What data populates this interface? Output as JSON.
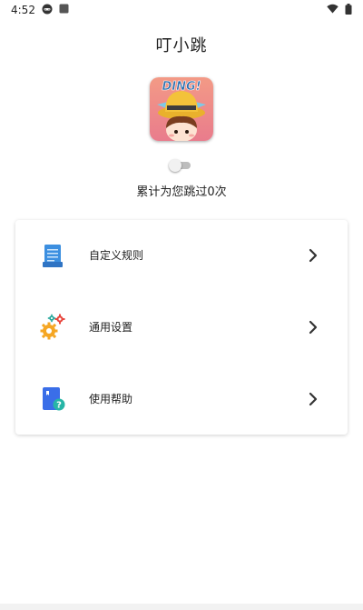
{
  "status_bar": {
    "time": "4:52",
    "icons": [
      "game-controller-icon",
      "square-app-icon",
      "wifi-icon",
      "battery-icon"
    ]
  },
  "app": {
    "title": "叮小跳",
    "logo_text": "DING!"
  },
  "toggle": {
    "enabled": false
  },
  "stats": {
    "skip_count_text": "累计为您跳过0次"
  },
  "menu": {
    "items": [
      {
        "label": "自定义规则",
        "icon": "document-icon"
      },
      {
        "label": "通用设置",
        "icon": "gears-icon"
      },
      {
        "label": "使用帮助",
        "icon": "help-book-icon"
      }
    ]
  },
  "colors": {
    "background": "#ffffff",
    "text": "#222222",
    "toggle_track": "#bdbdbd",
    "logo_background": "#e88c88",
    "hat_yellow": "#f3c23a",
    "document_blue": "#3c8fe0",
    "gear_orange": "#f5a623",
    "gear_red": "#e8453c",
    "gear_teal": "#26a69a",
    "help_blue": "#3a6ee8",
    "help_teal": "#26b5a6"
  }
}
